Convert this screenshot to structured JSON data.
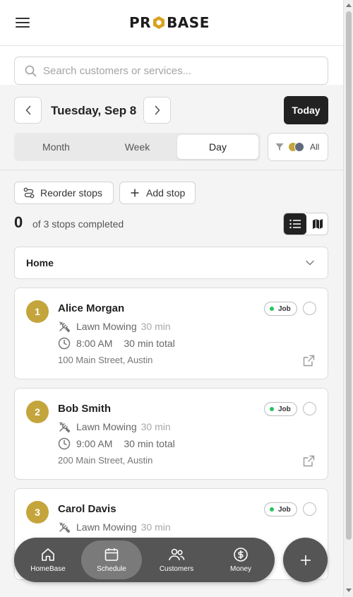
{
  "header": {
    "logo_text_left": "PR",
    "logo_text_right": "BASE",
    "menu_icon": "hamburger-icon"
  },
  "search": {
    "placeholder": "Search customers or services..."
  },
  "datebar": {
    "prev_icon": "chevron-left-icon",
    "next_icon": "chevron-right-icon",
    "date_label": "Tuesday, Sep 8",
    "today_label": "Today",
    "views": [
      "Month",
      "Week",
      "Day"
    ],
    "active_view": "Day",
    "filter_label": "All"
  },
  "actions": {
    "reorder_label": "Reorder stops",
    "add_stop_label": "Add stop"
  },
  "progress": {
    "completed": "0",
    "text": "of 3 stops completed",
    "completed_fraction": 0
  },
  "start_location": {
    "label": "Home"
  },
  "stops": [
    {
      "number": "1",
      "name": "Alice Morgan",
      "badge": "Job",
      "service": "Lawn Mowing",
      "duration": "30 min",
      "time": "8:00 AM",
      "total": "30 min total",
      "address": "100 Main Street, Austin"
    },
    {
      "number": "2",
      "name": "Bob Smith",
      "badge": "Job",
      "service": "Lawn Mowing",
      "duration": "30 min",
      "time": "9:00 AM",
      "total": "30 min total",
      "address": "200 Main Street, Austin"
    },
    {
      "number": "3",
      "name": "Carol Davis",
      "badge": "Job",
      "service": "Lawn Mowing",
      "duration": "30 min",
      "time": "",
      "total": "",
      "address": ""
    }
  ],
  "bottom_nav": {
    "tabs": [
      {
        "label": "HomeBase",
        "icon": "home-icon"
      },
      {
        "label": "Schedule",
        "icon": "calendar-icon"
      },
      {
        "label": "Customers",
        "icon": "users-icon"
      },
      {
        "label": "Money",
        "icon": "dollar-icon"
      }
    ],
    "active": "Schedule"
  },
  "colors": {
    "accent": "#c4a53c",
    "dark": "#222222",
    "job_dot": "#27c35a",
    "nav_bg": "#555555"
  }
}
